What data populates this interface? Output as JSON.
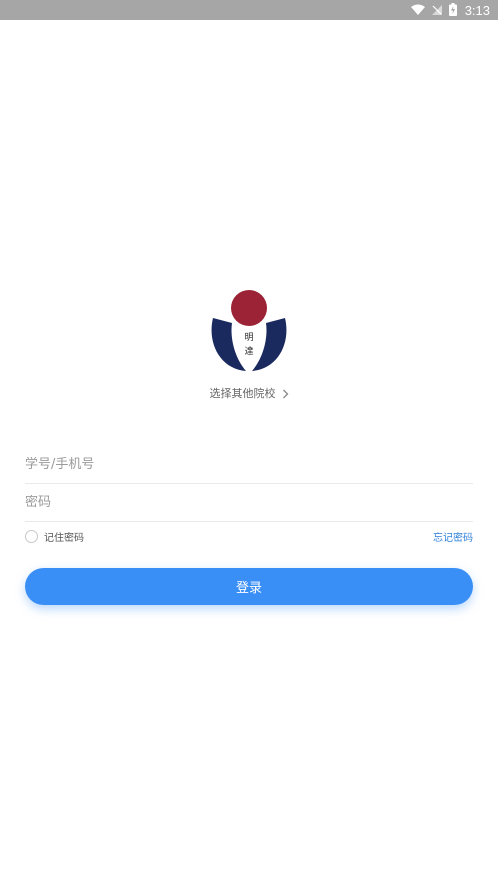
{
  "status_bar": {
    "time": "3:13",
    "icons": [
      "wifi-icon",
      "signal-off-icon",
      "battery-charging-icon"
    ]
  },
  "logo": {
    "text_line1": "明",
    "text_line2": "達",
    "colors": {
      "circle": "#9b2335",
      "wings": "#1b2a5e"
    }
  },
  "school_select": {
    "label": "选择其他院校"
  },
  "form": {
    "username_placeholder": "学号/手机号",
    "password_placeholder": "密码",
    "remember_label": "记住密码",
    "forgot_label": "忘记密码",
    "login_label": "登录"
  },
  "colors": {
    "accent": "#3a8ff7",
    "link": "#2d7fd8",
    "statusbar": "#a6a6a6"
  }
}
